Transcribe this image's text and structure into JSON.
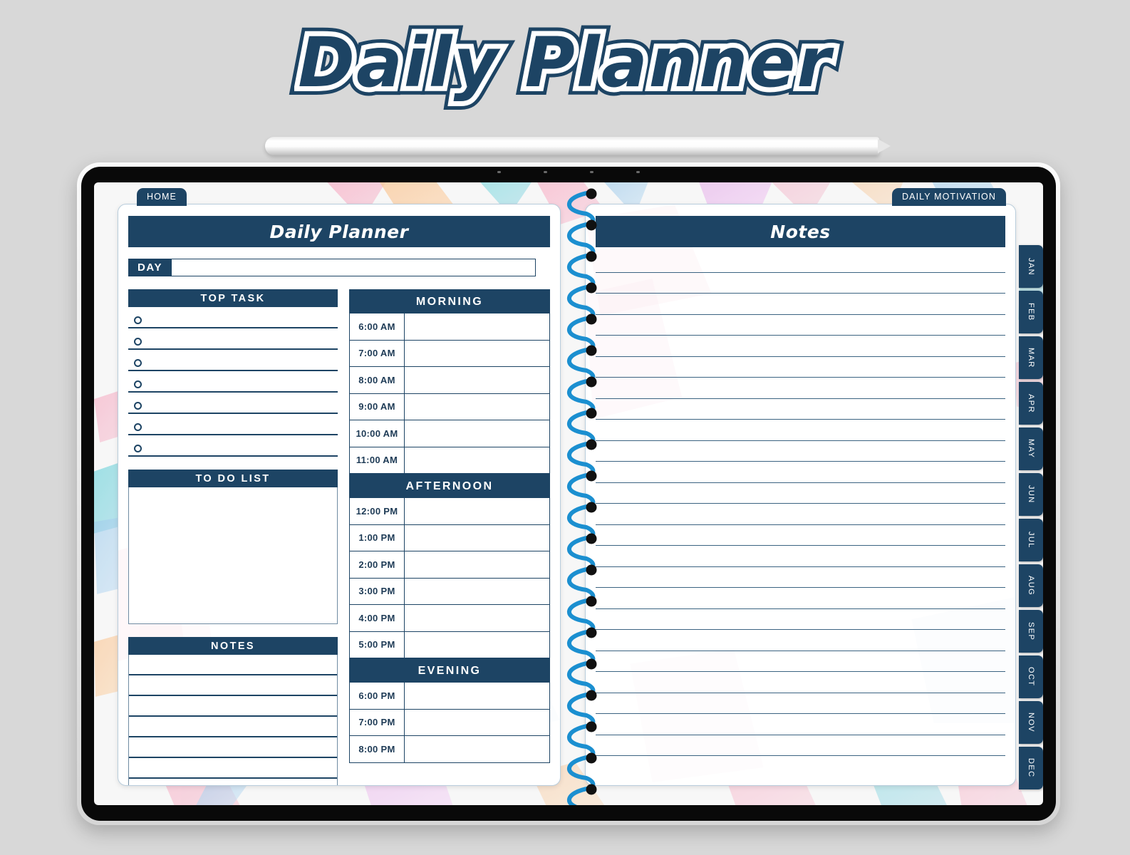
{
  "logo": {
    "text": "Daily Planner"
  },
  "device": {
    "type": "tablet",
    "stylus": "apple-pencil"
  },
  "tabs": {
    "home": "HOME",
    "motivation": "DAILY MOTIVATION"
  },
  "left_page": {
    "title": "Daily Planner",
    "day": {
      "label": "DAY",
      "value": "",
      "placeholder": ""
    },
    "top_task": {
      "header": "TOP TASK",
      "rows": [
        "",
        "",
        "",
        "",
        "",
        "",
        ""
      ]
    },
    "todo_list": {
      "header": "TO DO LIST",
      "value": ""
    },
    "notes": {
      "header": "NOTES",
      "rows": [
        "",
        "",
        "",
        "",
        "",
        "",
        ""
      ]
    },
    "schedule": [
      {
        "header": "MORNING",
        "slots": [
          {
            "time": "6:00 AM",
            "value": ""
          },
          {
            "time": "7:00 AM",
            "value": ""
          },
          {
            "time": "8:00 AM",
            "value": ""
          },
          {
            "time": "9:00 AM",
            "value": ""
          },
          {
            "time": "10:00 AM",
            "value": ""
          },
          {
            "time": "11:00 AM",
            "value": ""
          }
        ]
      },
      {
        "header": "AFTERNOON",
        "slots": [
          {
            "time": "12:00 PM",
            "value": ""
          },
          {
            "time": "1:00 PM",
            "value": ""
          },
          {
            "time": "2:00 PM",
            "value": ""
          },
          {
            "time": "3:00 PM",
            "value": ""
          },
          {
            "time": "4:00 PM",
            "value": ""
          },
          {
            "time": "5:00 PM",
            "value": ""
          }
        ]
      },
      {
        "header": "EVENING",
        "slots": [
          {
            "time": "6:00 PM",
            "value": ""
          },
          {
            "time": "7:00 PM",
            "value": ""
          },
          {
            "time": "8:00 PM",
            "value": ""
          }
        ]
      }
    ]
  },
  "right_page": {
    "title": "Notes",
    "line_count": 24
  },
  "month_tabs": [
    "JAN",
    "FEB",
    "MAR",
    "APR",
    "MAY",
    "JUN",
    "JUL",
    "AUG",
    "SEP",
    "OCT",
    "NOV",
    "DEC"
  ],
  "colors": {
    "navy": "#1d4464",
    "page_background": "#ffffff",
    "canvas_background": "#d8d8d8",
    "spiral_blue": "#1b8fd0",
    "bezel_black": "#090909"
  }
}
